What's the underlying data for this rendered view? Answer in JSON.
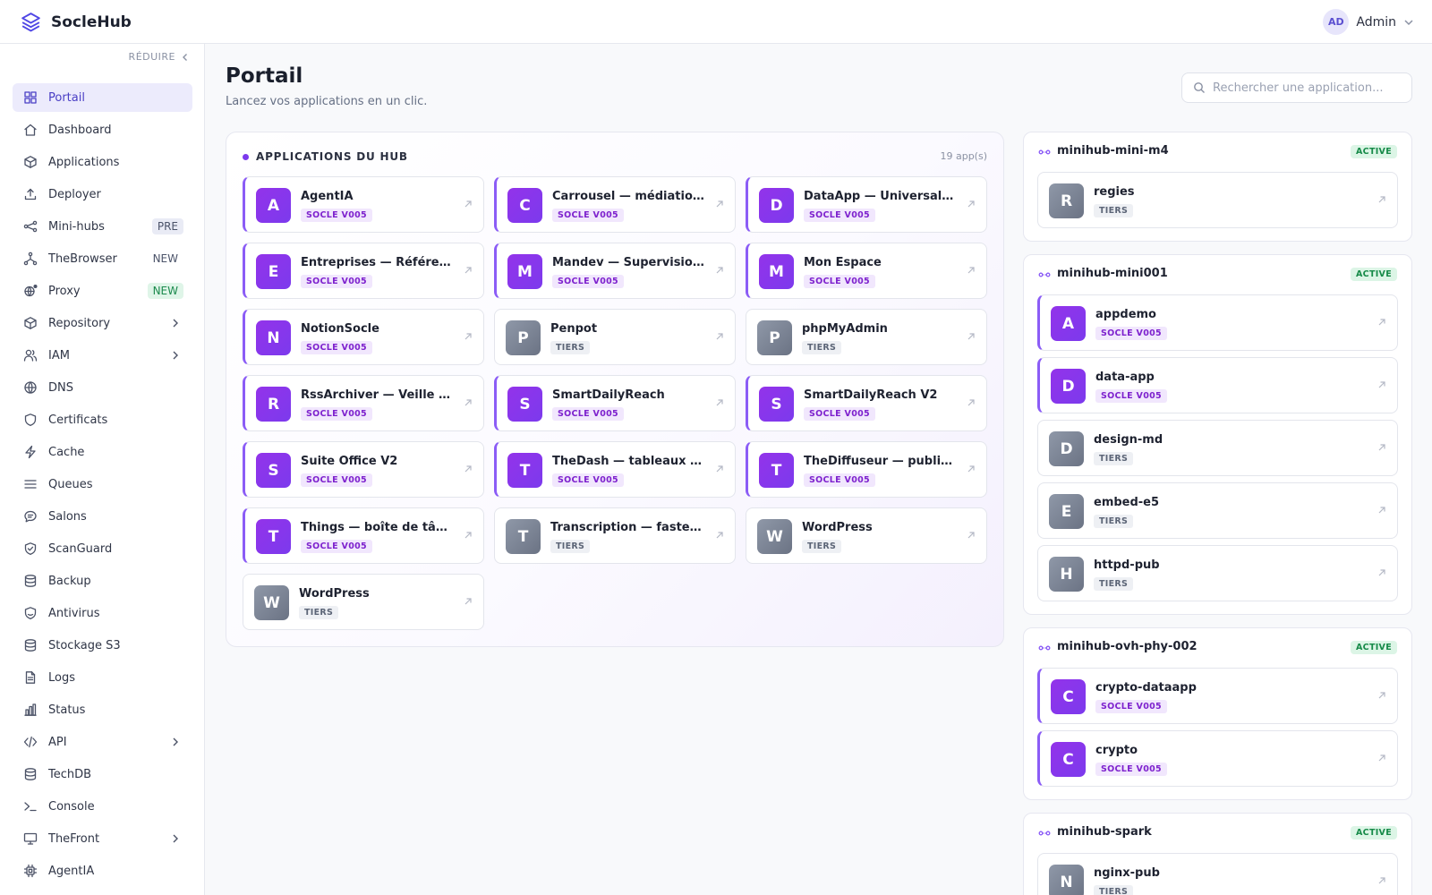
{
  "app": {
    "name": "SocleHub"
  },
  "user": {
    "initials": "AD",
    "name": "Admin"
  },
  "sidebar": {
    "collapse_label": "RÉDUIRE",
    "items": [
      {
        "label": "Portail",
        "icon": "grid-icon",
        "active": true
      },
      {
        "label": "Dashboard",
        "icon": "home-icon"
      },
      {
        "label": "Applications",
        "icon": "box-icon"
      },
      {
        "label": "Deployer",
        "icon": "upload-icon"
      },
      {
        "label": "Mini-hubs",
        "icon": "network-icon",
        "badge": "PRE",
        "badge_style": "pre"
      },
      {
        "label": "TheBrowser",
        "icon": "tree-icon",
        "badge": "NEW",
        "badge_style": "new-plain"
      },
      {
        "label": "Proxy",
        "icon": "globe-proxy-icon",
        "badge": "NEW",
        "badge_style": "new-green"
      },
      {
        "label": "Repository",
        "icon": "package-icon",
        "expandable": true
      },
      {
        "label": "IAM",
        "icon": "users-icon",
        "expandable": true
      },
      {
        "label": "DNS",
        "icon": "globe-icon"
      },
      {
        "label": "Certificats",
        "icon": "shield-icon"
      },
      {
        "label": "Cache",
        "icon": "bolt-icon"
      },
      {
        "label": "Queues",
        "icon": "list-icon"
      },
      {
        "label": "Salons",
        "icon": "chat-icon"
      },
      {
        "label": "ScanGuard",
        "icon": "shield-check-icon"
      },
      {
        "label": "Backup",
        "icon": "database-icon"
      },
      {
        "label": "Antivirus",
        "icon": "shield-virus-icon"
      },
      {
        "label": "Stockage S3",
        "icon": "storage-icon"
      },
      {
        "label": "Logs",
        "icon": "file-icon"
      },
      {
        "label": "Status",
        "icon": "bar-chart-icon"
      },
      {
        "label": "API",
        "icon": "code-icon",
        "expandable": true
      },
      {
        "label": "TechDB",
        "icon": "db-icon"
      },
      {
        "label": "Console",
        "icon": "terminal-icon"
      },
      {
        "label": "TheFront",
        "icon": "monitor-icon",
        "expandable": true
      },
      {
        "label": "AgentIA",
        "icon": "cpu-icon"
      }
    ]
  },
  "main": {
    "title": "Portail",
    "subtitle": "Lancez vos applications en un clic.",
    "search": {
      "placeholder": "Rechercher une application..."
    }
  },
  "hub": {
    "title": "APPLICATIONS DU HUB",
    "count": "19 app(s)",
    "apps": [
      {
        "letter": "A",
        "name": "AgentIA",
        "badge": "SOCLE V005",
        "kind": "socle"
      },
      {
        "letter": "C",
        "name": "Carrousel — médiation…",
        "badge": "SOCLE V005",
        "kind": "socle"
      },
      {
        "letter": "D",
        "name": "DataApp — Universal …",
        "badge": "SOCLE V005",
        "kind": "socle"
      },
      {
        "letter": "E",
        "name": "Entreprises — Référe…",
        "badge": "SOCLE V005",
        "kind": "socle"
      },
      {
        "letter": "M",
        "name": "Mandev — Supervisio…",
        "badge": "SOCLE V005",
        "kind": "socle"
      },
      {
        "letter": "M",
        "name": "Mon Espace",
        "badge": "SOCLE V005",
        "kind": "socle"
      },
      {
        "letter": "N",
        "name": "NotionSocle",
        "badge": "SOCLE V005",
        "kind": "socle"
      },
      {
        "letter": "P",
        "name": "Penpot",
        "badge": "TIERS",
        "kind": "tiers"
      },
      {
        "letter": "P",
        "name": "phpMyAdmin",
        "badge": "TIERS",
        "kind": "tiers"
      },
      {
        "letter": "R",
        "name": "RssArchiver — Veille …",
        "badge": "SOCLE V005",
        "kind": "socle"
      },
      {
        "letter": "S",
        "name": "SmartDailyReach",
        "badge": "SOCLE V005",
        "kind": "socle"
      },
      {
        "letter": "S",
        "name": "SmartDailyReach V2",
        "badge": "SOCLE V005",
        "kind": "socle"
      },
      {
        "letter": "S",
        "name": "Suite Office V2",
        "badge": "SOCLE V005",
        "kind": "socle"
      },
      {
        "letter": "T",
        "name": "TheDash — tableaux …",
        "badge": "SOCLE V005",
        "kind": "socle"
      },
      {
        "letter": "T",
        "name": "TheDiffuseur — public…",
        "badge": "SOCLE V005",
        "kind": "socle"
      },
      {
        "letter": "T",
        "name": "Things — boîte de tâc…",
        "badge": "SOCLE V005",
        "kind": "socle"
      },
      {
        "letter": "T",
        "name": "Transcription — faster…",
        "badge": "TIERS",
        "kind": "tiers"
      },
      {
        "letter": "W",
        "name": "WordPress",
        "badge": "TIERS",
        "kind": "tiers"
      },
      {
        "letter": "W",
        "name": "WordPress",
        "badge": "TIERS",
        "kind": "tiers"
      }
    ]
  },
  "minihubs": [
    {
      "name": "minihub-mini-m4",
      "status": "ACTIVE",
      "apps": [
        {
          "letter": "R",
          "name": "regies",
          "badge": "TIERS",
          "kind": "tiers"
        }
      ]
    },
    {
      "name": "minihub-mini001",
      "status": "ACTIVE",
      "apps": [
        {
          "letter": "A",
          "name": "appdemo",
          "badge": "SOCLE V005",
          "kind": "socle"
        },
        {
          "letter": "D",
          "name": "data-app",
          "badge": "SOCLE V005",
          "kind": "socle"
        },
        {
          "letter": "D",
          "name": "design-md",
          "badge": "TIERS",
          "kind": "tiers"
        },
        {
          "letter": "E",
          "name": "embed-e5",
          "badge": "TIERS",
          "kind": "tiers"
        },
        {
          "letter": "H",
          "name": "httpd-pub",
          "badge": "TIERS",
          "kind": "tiers"
        }
      ]
    },
    {
      "name": "minihub-ovh-phy-002",
      "status": "ACTIVE",
      "apps": [
        {
          "letter": "C",
          "name": "crypto-dataapp",
          "badge": "SOCLE V005",
          "kind": "socle"
        },
        {
          "letter": "C",
          "name": "crypto",
          "badge": "SOCLE V005",
          "kind": "socle"
        }
      ]
    },
    {
      "name": "minihub-spark",
      "status": "ACTIVE",
      "apps": [
        {
          "letter": "N",
          "name": "nginx-pub",
          "badge": "TIERS",
          "kind": "tiers"
        }
      ]
    }
  ],
  "colors": {
    "accent": "#4a3fc5",
    "socle": "#7c3aed",
    "tiers": "#7a8294",
    "active": "#168a48"
  }
}
